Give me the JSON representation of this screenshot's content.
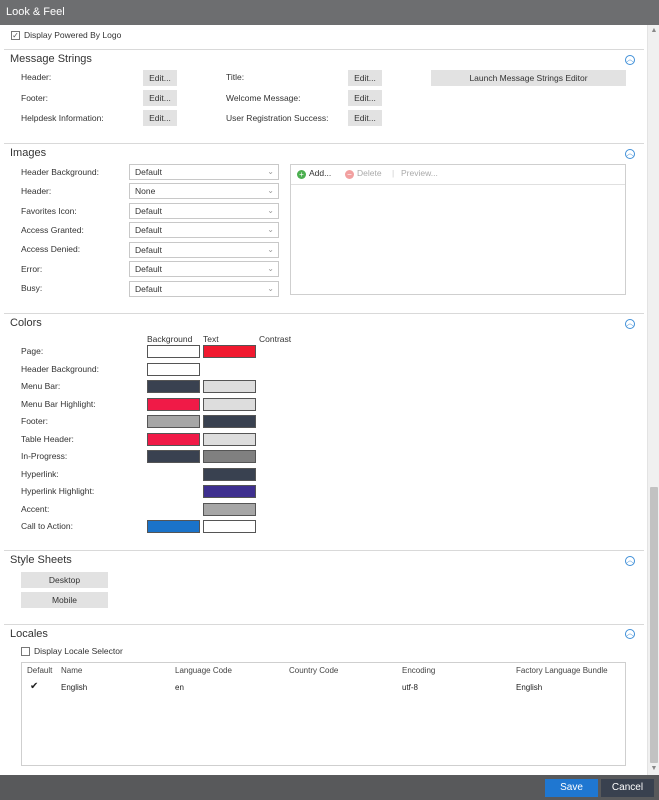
{
  "window": {
    "title": "Look & Feel"
  },
  "display_powered_by_logo": {
    "label": "Display Powered By Logo",
    "checked": true
  },
  "message_strings": {
    "title": "Message Strings",
    "rows": [
      {
        "label": "Header:",
        "button": "Edit..."
      },
      {
        "label": "Footer:",
        "button": "Edit..."
      },
      {
        "label": "Helpdesk Information:",
        "button": "Edit..."
      },
      {
        "label": "Title:",
        "button": "Edit..."
      },
      {
        "label": "Welcome Message:",
        "button": "Edit..."
      },
      {
        "label": "User Registration Success:",
        "button": "Edit..."
      }
    ],
    "launch_button": "Launch Message Strings Editor"
  },
  "images": {
    "title": "Images",
    "rows": [
      {
        "label": "Header Background:",
        "value": "Default"
      },
      {
        "label": "Header:",
        "value": "None"
      },
      {
        "label": "Favorites Icon:",
        "value": "Default"
      },
      {
        "label": "Access Granted:",
        "value": "Default"
      },
      {
        "label": "Access Denied:",
        "value": "Default"
      },
      {
        "label": "Error:",
        "value": "Default"
      },
      {
        "label": "Busy:",
        "value": "Default"
      }
    ],
    "toolbar": {
      "add": "Add...",
      "delete": "Delete",
      "preview": "Preview..."
    }
  },
  "colors": {
    "title": "Colors",
    "headers": {
      "background": "Background",
      "text": "Text",
      "contrast": "Contrast"
    },
    "rows": [
      {
        "label": "Page:",
        "background": "#ffffff",
        "text": "#f0192f"
      },
      {
        "label": "Header Background:",
        "background": "#ffffff",
        "text": null
      },
      {
        "label": "Menu Bar:",
        "background": "#394150",
        "text": "#dddddd"
      },
      {
        "label": "Menu Bar Highlight:",
        "background": "#f01a47",
        "text": "#dddddd"
      },
      {
        "label": "Footer:",
        "background": "#a6a6a6",
        "text": "#394150"
      },
      {
        "label": "Table Header:",
        "background": "#f01a47",
        "text": "#dddddd"
      },
      {
        "label": "In-Progress:",
        "background": "#394150",
        "text": "#808080"
      },
      {
        "label": "Hyperlink:",
        "background": null,
        "text": "#394150"
      },
      {
        "label": "Hyperlink Highlight:",
        "background": null,
        "text": "#3e2f8f"
      },
      {
        "label": "Accent:",
        "background": null,
        "text": "#a6a6a6"
      },
      {
        "label": "Call to Action:",
        "background": "#1a73c9",
        "text": "#ffffff"
      }
    ]
  },
  "style_sheets": {
    "title": "Style Sheets",
    "desktop": "Desktop",
    "mobile": "Mobile"
  },
  "locales": {
    "title": "Locales",
    "display_selector": {
      "label": "Display Locale Selector",
      "checked": false
    },
    "columns": [
      "Default",
      "Name",
      "Language Code",
      "Country Code",
      "Encoding",
      "Factory Language Bundle"
    ],
    "rows": [
      {
        "default": "✔",
        "name": "English",
        "language_code": "en",
        "country_code": "",
        "encoding": "utf-8",
        "factory_bundle": "English"
      }
    ]
  },
  "footer": {
    "save": "Save",
    "cancel": "Cancel"
  },
  "icons": {
    "collapse": "chevron-up-icon",
    "add": "plus-circle-icon",
    "delete": "minus-circle-icon",
    "dropdown": "chevron-down-icon"
  },
  "accent_color": "#3f8fd8"
}
